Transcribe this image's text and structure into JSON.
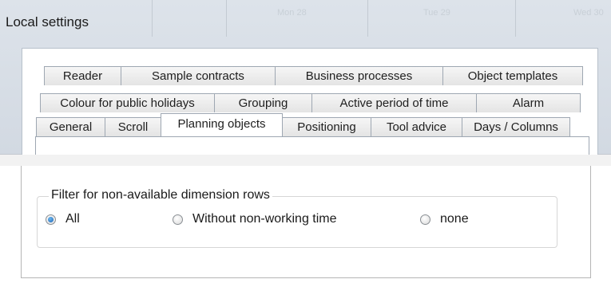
{
  "window": {
    "title": "Local settings"
  },
  "tabs": {
    "row1": [
      "Reader",
      "Sample contracts",
      "Business processes",
      "Object templates"
    ],
    "row2": [
      "Colour for public holidays",
      "Grouping",
      "Active period of time",
      "Alarm"
    ],
    "row3": [
      "General",
      "Scroll",
      "Planning objects",
      "Positioning",
      "Tool advice",
      "Days / Columns"
    ],
    "active": "Planning objects"
  },
  "filter_group": {
    "title": "Filter for non-available dimension rows",
    "options": [
      "All",
      "Without non-working time",
      "none"
    ],
    "selected": "All"
  },
  "background": {
    "headers": [
      "Mon 28",
      "Tue 29",
      "Wed 30"
    ]
  }
}
